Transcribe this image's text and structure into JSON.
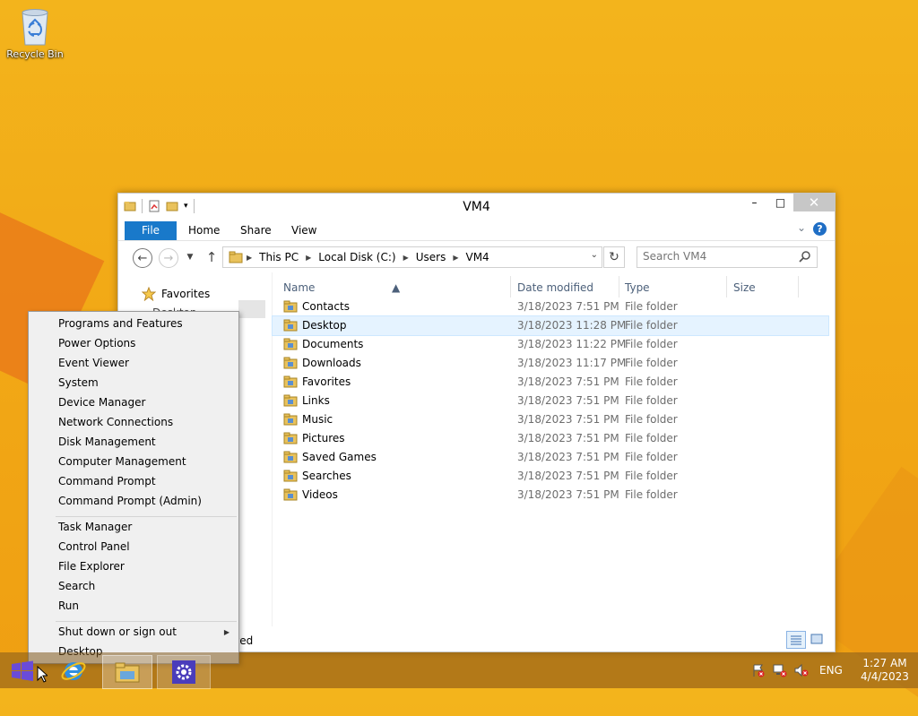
{
  "desktop": {
    "recycle_bin_label": "Recycle Bin"
  },
  "window": {
    "title": "VM4",
    "controls": {
      "minimize": "–",
      "maximize": "□",
      "close": "✕"
    },
    "ribbon_tabs": [
      "File",
      "Home",
      "Share",
      "View"
    ],
    "address": {
      "crumbs": [
        "This PC",
        "Local Disk (C:)",
        "Users",
        "VM4"
      ]
    },
    "search_placeholder": "Search VM4",
    "nav": {
      "favorites_label": "Favorites",
      "desktop_partial": "Desktop"
    },
    "columns": [
      "Name",
      "Date modified",
      "Type",
      "Size"
    ],
    "files": [
      {
        "name": "Contacts",
        "date": "3/18/2023 7:51 PM",
        "type": "File folder",
        "icon": "contacts-folder-icon"
      },
      {
        "name": "Desktop",
        "date": "3/18/2023 11:28 PM",
        "type": "File folder",
        "icon": "desktop-folder-icon",
        "selected": true
      },
      {
        "name": "Documents",
        "date": "3/18/2023 11:22 PM",
        "type": "File folder",
        "icon": "documents-folder-icon"
      },
      {
        "name": "Downloads",
        "date": "3/18/2023 11:17 PM",
        "type": "File folder",
        "icon": "downloads-folder-icon"
      },
      {
        "name": "Favorites",
        "date": "3/18/2023 7:51 PM",
        "type": "File folder",
        "icon": "favorites-folder-icon"
      },
      {
        "name": "Links",
        "date": "3/18/2023 7:51 PM",
        "type": "File folder",
        "icon": "links-folder-icon"
      },
      {
        "name": "Music",
        "date": "3/18/2023 7:51 PM",
        "type": "File folder",
        "icon": "music-folder-icon"
      },
      {
        "name": "Pictures",
        "date": "3/18/2023 7:51 PM",
        "type": "File folder",
        "icon": "pictures-folder-icon"
      },
      {
        "name": "Saved Games",
        "date": "3/18/2023 7:51 PM",
        "type": "File folder",
        "icon": "saved-games-folder-icon"
      },
      {
        "name": "Searches",
        "date": "3/18/2023 7:51 PM",
        "type": "File folder",
        "icon": "searches-folder-icon"
      },
      {
        "name": "Videos",
        "date": "3/18/2023 7:51 PM",
        "type": "File folder",
        "icon": "videos-folder-icon"
      }
    ],
    "status_text": "cted"
  },
  "context_menu": {
    "group1": [
      "Programs and Features",
      "Power Options",
      "Event Viewer",
      "System",
      "Device Manager",
      "Network Connections",
      "Disk Management",
      "Computer Management",
      "Command Prompt",
      "Command Prompt (Admin)"
    ],
    "group2": [
      "Task Manager",
      "Control Panel",
      "File Explorer",
      "Search",
      "Run"
    ],
    "group3": [
      "Shut down or sign out",
      "Desktop"
    ]
  },
  "taskbar": {
    "language": "ENG",
    "time": "1:27 AM",
    "date": "4/4/2023"
  },
  "colors": {
    "accent": "#1979ca",
    "desktop_bg": "#f2a916",
    "selection": "#e5f3ff"
  }
}
